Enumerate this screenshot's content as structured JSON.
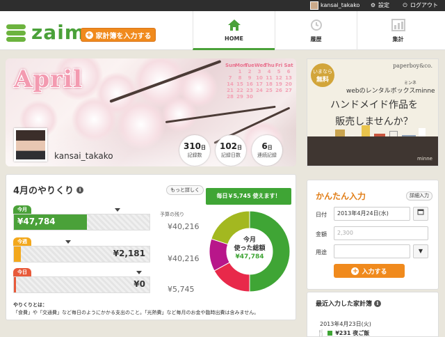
{
  "topbar": {
    "username": "kansai_takako",
    "settings": "設定",
    "logout": "ログアウト"
  },
  "header": {
    "logo": "zaim",
    "add_book": "家計簿を入力する",
    "tabs": [
      {
        "label": "HOME",
        "icon": "home-icon"
      },
      {
        "label": "履歴",
        "icon": "clock-icon"
      },
      {
        "label": "集計",
        "icon": "bar-chart-icon"
      }
    ]
  },
  "profile": {
    "month": "April",
    "calendar_head": [
      "Sun",
      "Mon",
      "Tue",
      "Wed",
      "Thu",
      "Fri",
      "Sat"
    ],
    "calendar_rows": [
      [
        "",
        "1",
        "2",
        "3",
        "4",
        "5",
        "6"
      ],
      [
        "7",
        "8",
        "9",
        "10",
        "11",
        "12",
        "13"
      ],
      [
        "14",
        "15",
        "16",
        "17",
        "18",
        "19",
        "20"
      ],
      [
        "21",
        "22",
        "23",
        "24",
        "25",
        "26",
        "27"
      ],
      [
        "28",
        "29",
        "30",
        "",
        "",
        "",
        ""
      ]
    ],
    "username": "kansai_takako",
    "stats": [
      {
        "value": "310",
        "unit": "日",
        "label": "記録数"
      },
      {
        "value": "102",
        "unit": "日",
        "label": "記録日数"
      },
      {
        "value": "6",
        "unit": "日",
        "label": "連続記録"
      }
    ]
  },
  "ad": {
    "brand": "paperboy&co.",
    "badge_line1": "いまなら",
    "badge_line2": "無料",
    "sub": "webのレンタルボックスminne",
    "ruby": "ミンネ",
    "line1": "ハンドメイド作品を",
    "line2": "販売しませんか？",
    "footer": "minne"
  },
  "budget": {
    "title": "4月のやりくり",
    "more": "もっと詳しく",
    "daily": "毎日￥5,745 使えます！",
    "remain_head": "予算の残り",
    "rows": [
      {
        "tag": "今月",
        "amount": "¥47,784",
        "remain": "¥40,216",
        "fill": 0.54,
        "pointer": 0.76,
        "color": "#4aa139"
      },
      {
        "tag": "今週",
        "amount": "¥2,181",
        "remain": "¥40,216",
        "fill": 0.05,
        "pointer": 0.4,
        "color": "#f3a81c"
      },
      {
        "tag": "今日",
        "amount": "¥0",
        "remain": "¥5,745",
        "fill": 0.0,
        "pointer": 0.92,
        "color": "#e85a3a"
      }
    ],
    "donut_line1": "今月",
    "donut_line2": "使った総額",
    "donut_amount": "¥47,784",
    "notes_line1": "やりくりとは：",
    "notes_line2": "「食費」や「交通費」など毎日のようにかかる支出のこと。「光熱費」など毎月のお金や臨時出費は含みません。",
    "segments": [
      {
        "share": 0.5,
        "color": "#3fa535"
      },
      {
        "share": 0.17,
        "color": "#e8294a"
      },
      {
        "share": 0.13,
        "color": "#b8168a"
      },
      {
        "share": 0.2,
        "color": "#a3b820"
      }
    ]
  },
  "quick": {
    "title": "かんたん入力",
    "detail": "詳細入力",
    "date_label": "日付",
    "date_value": "2013年4月24日(水)",
    "amount_label": "金額",
    "amount_placeholder": "2,300",
    "category_label": "用途",
    "submit": "入力する"
  },
  "recent": {
    "title": "最近入力した家計簿",
    "date": "2013年4月23日(火)",
    "item": "¥231 夜ご飯"
  }
}
